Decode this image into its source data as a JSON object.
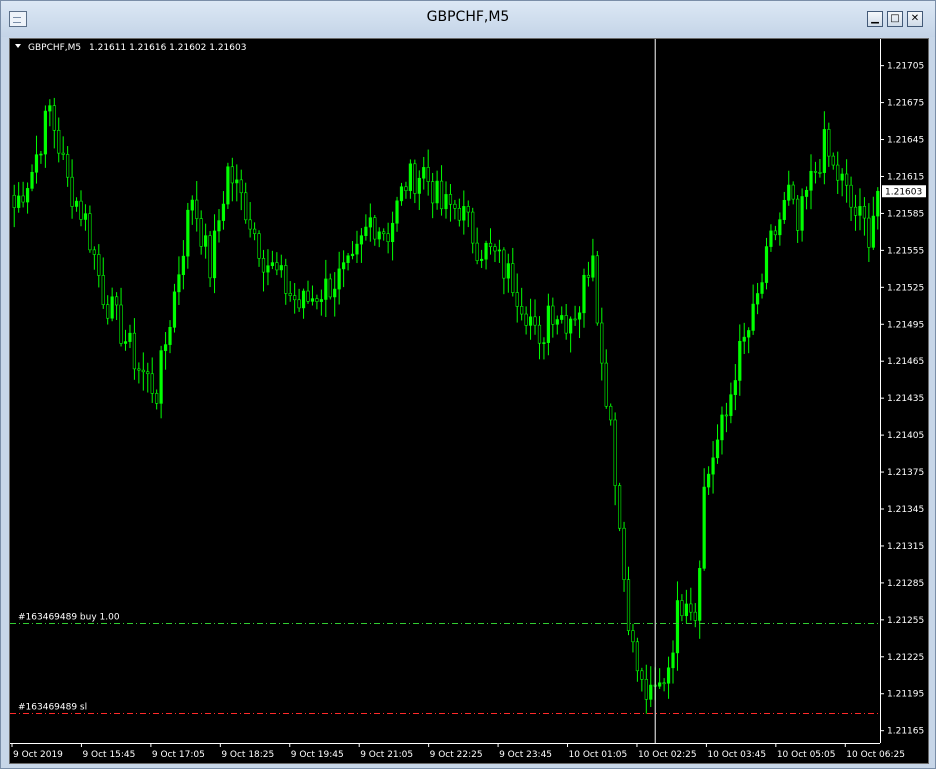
{
  "window": {
    "title": "GBPCHF,M5",
    "buttons": {
      "minimize": "▁",
      "maximize": "□",
      "close": "✕"
    }
  },
  "chart_data": {
    "type": "candlestick",
    "symbol_label": "GBPCHF,M5",
    "ohlc_label": "1.21611 1.21616 1.21602 1.21603",
    "current_price_label": "1.21603",
    "current_price": 1.21603,
    "ylim": [
      1.21155,
      1.21725
    ],
    "y_ticks": [
      "1.21705",
      "1.21675",
      "1.21645",
      "1.21615",
      "1.21585",
      "1.21555",
      "1.21525",
      "1.21495",
      "1.21465",
      "1.21435",
      "1.21405",
      "1.21375",
      "1.21345",
      "1.21315",
      "1.21285",
      "1.21255",
      "1.21225",
      "1.21195",
      "1.21165"
    ],
    "x_ticks": [
      "9 Oct 2019",
      "9 Oct 15:45",
      "9 Oct 17:05",
      "9 Oct 18:25",
      "9 Oct 19:45",
      "9 Oct 21:05",
      "9 Oct 22:25",
      "9 Oct 23:45",
      "10 Oct 01:05",
      "10 Oct 02:25",
      "10 Oct 03:45",
      "10 Oct 05:05",
      "10 Oct 06:25"
    ],
    "bar_count": 195,
    "vline_index": 144,
    "levels": [
      {
        "label": "#163469489 buy 1.00",
        "price": 1.21252,
        "color": "#32cd32"
      },
      {
        "label": "#163469489 sl",
        "price": 1.21179,
        "color": "#ff2a2a"
      }
    ],
    "close_path": [
      [
        0,
        1.2159
      ],
      [
        4,
        1.2162
      ],
      [
        8,
        1.2167
      ],
      [
        12,
        1.2161
      ],
      [
        16,
        1.2158
      ],
      [
        20,
        1.2152
      ],
      [
        24,
        1.2149
      ],
      [
        28,
        1.2146
      ],
      [
        32,
        1.2144
      ],
      [
        36,
        1.2152
      ],
      [
        40,
        1.216
      ],
      [
        44,
        1.2154
      ],
      [
        48,
        1.2162
      ],
      [
        52,
        1.2159
      ],
      [
        56,
        1.2155
      ],
      [
        60,
        1.2153
      ],
      [
        64,
        1.2151
      ],
      [
        68,
        1.2152
      ],
      [
        72,
        1.2153
      ],
      [
        76,
        1.2154
      ],
      [
        80,
        1.2158
      ],
      [
        84,
        1.2157
      ],
      [
        88,
        1.2161
      ],
      [
        92,
        1.2162
      ],
      [
        96,
        1.2159
      ],
      [
        100,
        1.2159
      ],
      [
        104,
        1.2156
      ],
      [
        108,
        1.2155
      ],
      [
        112,
        1.2153
      ],
      [
        116,
        1.215
      ],
      [
        118,
        1.2147
      ],
      [
        120,
        1.2151
      ],
      [
        124,
        1.215
      ],
      [
        127,
        1.2151
      ],
      [
        130,
        1.2156
      ],
      [
        132,
        1.2146
      ],
      [
        134,
        1.2142
      ],
      [
        136,
        1.2133
      ],
      [
        137,
        1.2129
      ],
      [
        139,
        1.2123
      ],
      [
        141,
        1.212
      ],
      [
        143,
        1.2119
      ],
      [
        145,
        1.212
      ],
      [
        147,
        1.2122
      ],
      [
        149,
        1.2126
      ],
      [
        151,
        1.2128
      ],
      [
        153,
        1.2126
      ],
      [
        155,
        1.2136
      ],
      [
        157,
        1.2139
      ],
      [
        160,
        1.2142
      ],
      [
        162,
        1.2146
      ],
      [
        164,
        1.2148
      ],
      [
        166,
        1.215
      ],
      [
        168,
        1.2153
      ],
      [
        170,
        1.2156
      ],
      [
        172,
        1.2158
      ],
      [
        174,
        1.216
      ],
      [
        176,
        1.2157
      ],
      [
        178,
        1.216
      ],
      [
        180,
        1.2162
      ],
      [
        182,
        1.2164
      ],
      [
        184,
        1.2162
      ],
      [
        186,
        1.2161
      ],
      [
        188,
        1.2159
      ],
      [
        190,
        1.2158
      ],
      [
        192,
        1.2157
      ],
      [
        194,
        1.21603
      ]
    ]
  },
  "colors": {
    "candle": "#00ff00",
    "background": "#000000",
    "foreground": "#ffffff"
  }
}
